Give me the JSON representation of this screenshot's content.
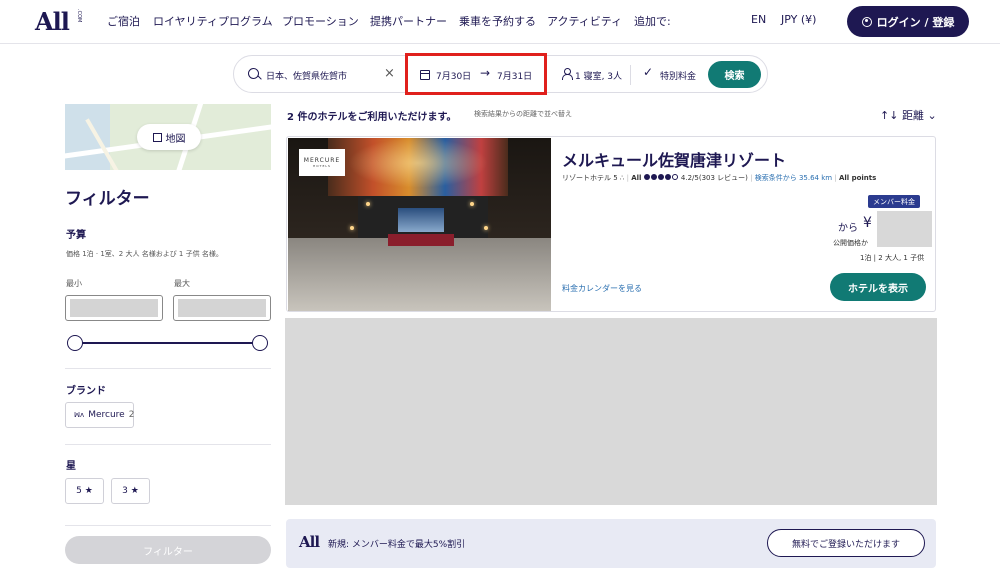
{
  "header": {
    "logo": "All",
    "logo_sup": ".COM",
    "nav": [
      "ご宿泊",
      "ロイヤリティプログラム",
      "プロモーション",
      "提携パートナー",
      "乗車を予約する",
      "アクティビティ",
      "追加で:"
    ],
    "lang": "EN",
    "currency": "JPY (¥)",
    "login_label": "ログイン / 登録"
  },
  "search": {
    "destination": "日本、佐賀県佐賀市",
    "clear": "×",
    "checkin": "7月30日",
    "arrow": "→",
    "checkout": "7月31日",
    "guests": "1 寝室, 3人",
    "special_rate_check": "✓",
    "special_rate": "特別料金",
    "search_button": "検索"
  },
  "sidebar": {
    "map_button": "地図",
    "filter_title": "フィルター",
    "budget": {
      "title": "予算",
      "note": "価格 1泊 · 1室、2 大人 名様および 1 子供 名様。",
      "min_label": "最小",
      "max_label": "最大"
    },
    "brand": {
      "title": "ブランド",
      "items": [
        {
          "logo": "ꟽᴧ",
          "label": "Mercure",
          "count": "2"
        }
      ]
    },
    "stars": {
      "title": "星",
      "items": [
        "5 ★",
        "3 ★"
      ]
    },
    "filter_button": "フィルター"
  },
  "results": {
    "count_text": "2 件のホテルをご利用いただけます。",
    "sort_note": "検索結果からの距離で並べ替え",
    "sort_label": "距離",
    "sort_icon": "↑↓",
    "sort_caret": "⌄"
  },
  "hotel": {
    "brand_badge": "MERCURE",
    "brand_badge_sub": "HOTELS",
    "name": "メルキュール佐賀唐津リゾート",
    "type": "リゾートホテル 5",
    "all_label": "All",
    "rating": "4.2/5(303 レビュー)",
    "distance": "検索条件から 35.64 km",
    "points": "All points",
    "member_rate": "メンバー料金",
    "price_from": "から",
    "currency_symbol": "¥",
    "public_price": "公開価格か",
    "stay_info": "1泊 | 2 大人, 1 子供",
    "calendar_link": "料金カレンダーを見る",
    "view_button": "ホテルを表示"
  },
  "promo": {
    "logo": "All",
    "text": "新規: メンバー料金で最大5%割引",
    "button": "無料でご登録いただけます"
  }
}
